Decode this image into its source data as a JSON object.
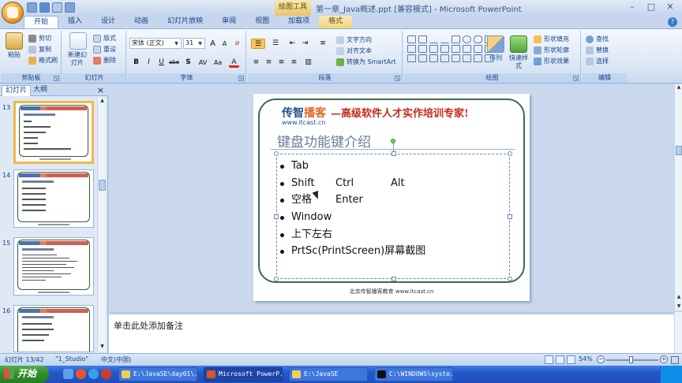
{
  "window": {
    "title": "第一章_Java概述.ppt [兼容模式] - Microsoft PowerPoint",
    "context_tab_title": "绘图工具",
    "controls": [
      "–",
      "□",
      "✕"
    ]
  },
  "ribbon": {
    "tabs": [
      "开始",
      "插入",
      "设计",
      "动画",
      "幻灯片放映",
      "审阅",
      "视图",
      "加载项",
      "格式"
    ],
    "clipboard": {
      "label": "剪贴板",
      "paste": "粘贴",
      "cut": "剪切",
      "copy": "复制",
      "format_painter": "格式刷"
    },
    "slides": {
      "label": "幻灯片",
      "new_slide": "新建幻灯片",
      "layout": "版式",
      "reset": "重设",
      "delete": "删除"
    },
    "font": {
      "label": "字体",
      "font_name": "宋体 (正文)",
      "font_size": "31",
      "grow": "A",
      "shrink": "A",
      "bold": "B",
      "italic": "I",
      "underline": "U",
      "strike": "abe",
      "shadow": "S",
      "spacing": "AV",
      "case": "Aa",
      "color": "A"
    },
    "paragraph": {
      "label": "段落",
      "text_direction": "文字方向",
      "align_text": "对齐文本",
      "smartart": "转换为 SmartArt"
    },
    "drawing": {
      "label": "绘图",
      "arrange": "排列",
      "quick_styles": "快速样式",
      "shape_fill": "形状填充",
      "shape_outline": "形状轮廓",
      "shape_effects": "形状效果"
    },
    "editing": {
      "label": "编辑",
      "find": "查找",
      "replace": "替换",
      "select": "选择"
    }
  },
  "left_panel": {
    "tabs": [
      "幻灯片",
      "大纲"
    ],
    "close": "×",
    "slide_numbers": [
      "13",
      "14",
      "15",
      "16"
    ]
  },
  "slide": {
    "logo_part1": "传智",
    "logo_part2": "播客",
    "logo_slogan": "—高级软件人才实作培训专家!",
    "logo_url": "www.itcast.cn",
    "title": "键盘功能键介绍",
    "bullets": [
      {
        "a": "Tab",
        "b": "",
        "c": ""
      },
      {
        "a": "Shift",
        "b": "Ctrl",
        "c": "Alt"
      },
      {
        "a": "空格",
        "b": "Enter",
        "c": ""
      },
      {
        "a": "Window",
        "b": "",
        "c": ""
      },
      {
        "a": "上下左右",
        "b": "",
        "c": ""
      },
      {
        "a": "PrtSc(PrintScreen)屏幕截图",
        "b": "",
        "c": ""
      }
    ],
    "footer": "北京传智播客教育 www.itcast.cn"
  },
  "notes": {
    "placeholder": "单击此处添加备注"
  },
  "status": {
    "slide_count": "幻灯片 13/42",
    "theme": "\"1_Studio\"",
    "language": "中文(中国)",
    "zoom": "54%",
    "zoom_minus": "−",
    "zoom_plus": "+"
  },
  "taskbar": {
    "start": "开始",
    "tasks": [
      "E:\\JavaSE\\day01\\...",
      "Microsoft PowerP...",
      "E:\\JavaSE",
      "C:\\WINDOWS\\syste..."
    ]
  },
  "colors": {
    "accent": "#15428b",
    "ribbon": "#dbe6f4",
    "slide_frame": "#3b6b4a",
    "selection": "#f3b64c"
  }
}
